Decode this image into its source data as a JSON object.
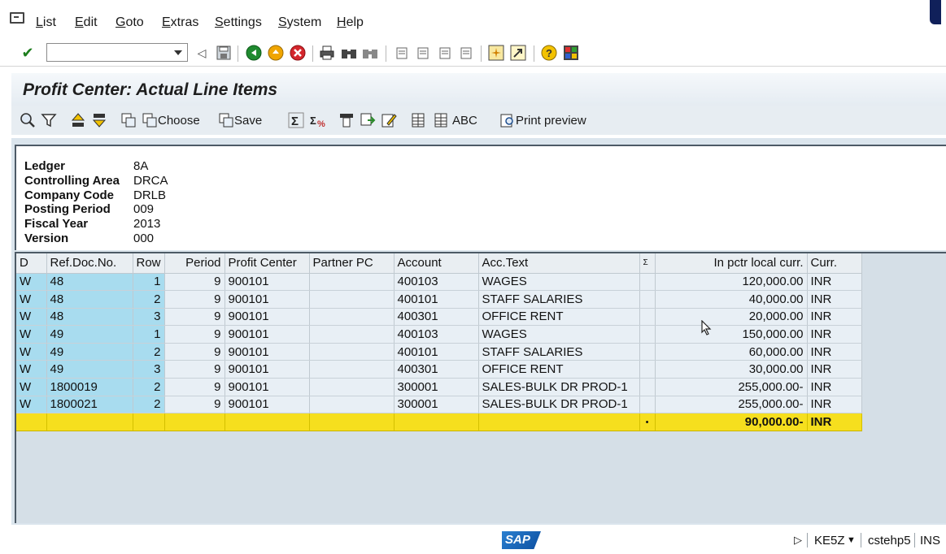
{
  "menu": {
    "items": [
      "List",
      "Edit",
      "Goto",
      "Extras",
      "Settings",
      "System",
      "Help"
    ]
  },
  "system_toolbar": {
    "command_field_value": "",
    "icons": [
      "enter-icon",
      "back-icon",
      "save-icon",
      "back-green-icon",
      "exit-icon",
      "cancel-icon",
      "print-icon",
      "find-icon",
      "find-next-icon",
      "first-page-icon",
      "prev-page-icon",
      "next-page-icon",
      "last-page-icon",
      "new-session-icon",
      "shortcut-icon",
      "help-icon",
      "customize-layout-icon"
    ]
  },
  "title": "Profit Center: Actual Line Items",
  "app_toolbar": {
    "choose_label": "Choose",
    "save_label": "Save",
    "abc_label": "ABC",
    "print_preview_label": "Print preview"
  },
  "header": [
    {
      "label": "Ledger",
      "value": "8A"
    },
    {
      "label": "Controlling Area",
      "value": "DRCA"
    },
    {
      "label": "Company Code",
      "value": "DRLB"
    },
    {
      "label": "Posting Period",
      "value": "009"
    },
    {
      "label": "Fiscal Year",
      "value": "2013"
    },
    {
      "label": "Version",
      "value": "000"
    }
  ],
  "grid": {
    "columns": {
      "d": "D",
      "refdoc": "Ref.Doc.No.",
      "row": "Row",
      "period": "Period",
      "profit_center": "Profit Center",
      "partner_pc": "Partner PC",
      "account": "Account",
      "acc_text": "Acc.Text",
      "sigma": "Σ",
      "amount": "In pctr local curr.",
      "curr": "Curr."
    },
    "rows": [
      {
        "d": "W",
        "refdoc": "48",
        "row": "1",
        "period": "9",
        "pc": "900101",
        "ppc": "",
        "account": "400103",
        "text": "WAGES",
        "amount": "120,000.00",
        "curr": "INR"
      },
      {
        "d": "W",
        "refdoc": "48",
        "row": "2",
        "period": "9",
        "pc": "900101",
        "ppc": "",
        "account": "400101",
        "text": "STAFF SALARIES",
        "amount": "40,000.00",
        "curr": "INR"
      },
      {
        "d": "W",
        "refdoc": "48",
        "row": "3",
        "period": "9",
        "pc": "900101",
        "ppc": "",
        "account": "400301",
        "text": "OFFICE RENT",
        "amount": "20,000.00",
        "curr": "INR"
      },
      {
        "d": "W",
        "refdoc": "49",
        "row": "1",
        "period": "9",
        "pc": "900101",
        "ppc": "",
        "account": "400103",
        "text": "WAGES",
        "amount": "150,000.00",
        "curr": "INR"
      },
      {
        "d": "W",
        "refdoc": "49",
        "row": "2",
        "period": "9",
        "pc": "900101",
        "ppc": "",
        "account": "400101",
        "text": "STAFF SALARIES",
        "amount": "60,000.00",
        "curr": "INR"
      },
      {
        "d": "W",
        "refdoc": "49",
        "row": "3",
        "period": "9",
        "pc": "900101",
        "ppc": "",
        "account": "400301",
        "text": "OFFICE RENT",
        "amount": "30,000.00",
        "curr": "INR"
      },
      {
        "d": "W",
        "refdoc": "1800019",
        "row": "2",
        "period": "9",
        "pc": "900101",
        "ppc": "",
        "account": "300001",
        "text": "SALES-BULK DR PROD-1",
        "amount": "255,000.00-",
        "curr": "INR"
      },
      {
        "d": "W",
        "refdoc": "1800021",
        "row": "2",
        "period": "9",
        "pc": "900101",
        "ppc": "",
        "account": "300001",
        "text": "SALES-BULK DR PROD-1",
        "amount": "255,000.00-",
        "curr": "INR"
      }
    ],
    "total": {
      "marker": "•",
      "amount": "90,000.00-",
      "curr": "INR"
    }
  },
  "status_bar": {
    "logo": "SAP",
    "transaction": "KE5Z",
    "server": "cstehp5",
    "mode": "INS"
  }
}
